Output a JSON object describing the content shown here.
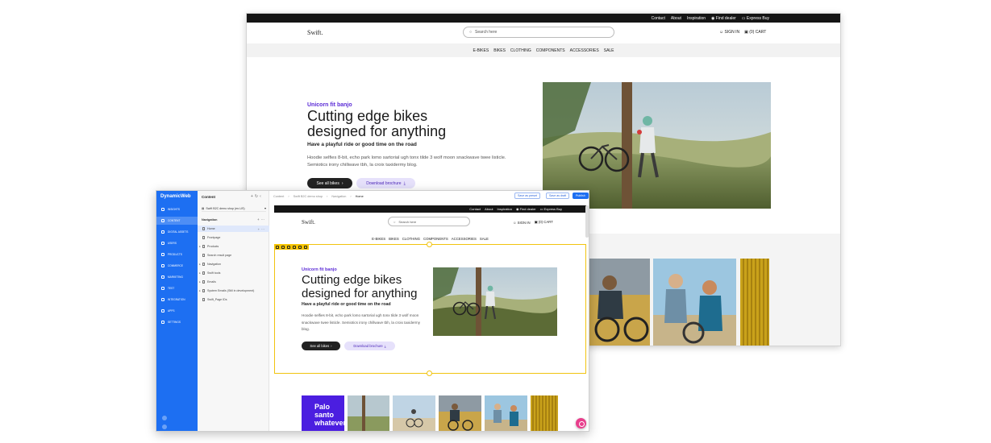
{
  "storefront": {
    "topbar": [
      "Contact",
      "About",
      "Inspiration",
      "Find dealer",
      "Express Buy"
    ],
    "logo": "Swift.",
    "search_placeholder": "Search here",
    "sign_in": "SIGN IN",
    "cart": "(0) CART",
    "nav": [
      "E-BIKES",
      "BIKES",
      "CLOTHING",
      "COMPONENTS",
      "ACCESSORIES",
      "SALE"
    ],
    "hero": {
      "eyebrow": "Unicorn fit banjo",
      "title": "Cutting edge bikes designed for anything",
      "subtitle": "Have a playful ride or good time on the road",
      "body": "Hoodie selfies 8-bit, echo park lomo sartorial ugh tonx tilde 3 wolf moon snackwave twee listicle. Semiotics irony chillwave tbh, la croix taxidermy blog.",
      "primary_button": "See all bikes",
      "secondary_button": "Download brochure"
    }
  },
  "admin": {
    "brand": "DynamicWeb",
    "nav": [
      {
        "label": "Insights",
        "icon": "insights-icon"
      },
      {
        "label": "Content",
        "icon": "content-icon",
        "active": true
      },
      {
        "label": "Digital assets",
        "icon": "digital-assets-icon"
      },
      {
        "label": "Users",
        "icon": "users-icon"
      },
      {
        "label": "Products",
        "icon": "products-icon"
      },
      {
        "label": "Commerce",
        "icon": "commerce-icon"
      },
      {
        "label": "Marketing",
        "icon": "marketing-icon"
      },
      {
        "label": "Test",
        "icon": "test-icon"
      },
      {
        "label": "Integration",
        "icon": "integration-icon"
      },
      {
        "label": "Apps",
        "icon": "apps-icon"
      },
      {
        "label": "Settings",
        "icon": "settings-icon"
      }
    ],
    "tree": {
      "title": "Content",
      "website": "Swift B2C demo shop (en-US)",
      "section": "Navigation",
      "items": [
        {
          "label": "Home",
          "active": true
        },
        {
          "label": "Frontpage"
        },
        {
          "label": "Products",
          "caret": "▸"
        },
        {
          "label": "Search result page"
        },
        {
          "label": "Navigation",
          "caret": "▸"
        },
        {
          "label": "Swift tools",
          "caret": "▸"
        },
        {
          "label": "Emails",
          "caret": "▸"
        },
        {
          "label": "System Emails (Still in development)",
          "caret": "▸"
        },
        {
          "label": "Swift_Page IDs"
        }
      ]
    },
    "breadcrumb": [
      "Content",
      "Swift B2C demo shop",
      "Navigation",
      "Home"
    ],
    "toolbar": {
      "save_preset": "Save as preset",
      "save_draft": "Save as draft",
      "publish": "Publish"
    },
    "preview": {
      "topbar": [
        "Contact",
        "About",
        "Inspiration",
        "Find dealer",
        "Express Buy"
      ],
      "logo": "Swift.",
      "search_placeholder": "Search here",
      "sign_in": "SIGN IN",
      "cart": "(0) CART",
      "nav": [
        "E-BIKES",
        "BIKES",
        "CLOTHING",
        "COMPONENTS",
        "ACCESSORIES",
        "SALE"
      ],
      "eyebrow": "Unicorn fit banjo",
      "title": "Cutting edge bikes designed for anything",
      "subtitle": "Have a playful ride or good time on the road",
      "body": "Hoodie selfies 8-bit, echo park lomo sartorial ugh tonx tilde 3 wolf moon snackwave twee listicle. Semiotics irony chillwave tbh, la croix taxidermy blog.",
      "primary_button": "See all bikes",
      "secondary_button": "Download brochure",
      "tile_text": "Palo santo whatever"
    }
  },
  "colors": {
    "admin_blue": "#1d6ff2",
    "accent_purple": "#5b2bd6",
    "editor_yellow": "#f1c40f",
    "fab_pink": "#e83e8c"
  }
}
